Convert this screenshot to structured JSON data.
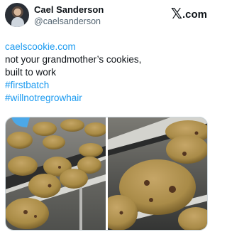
{
  "author": {
    "display_name": "Cael Sanderson",
    "handle": "@caelsanderson",
    "avatar_icon": "profile-avatar"
  },
  "brand": {
    "mark": "𝕏",
    "label": ".com"
  },
  "post": {
    "lines": [
      "caelscookie.com",
      "not your grandmother’s cookies,",
      "built to work",
      "#firstbatch",
      "#willnotregrowhair"
    ]
  },
  "media": {
    "photos": [
      {
        "icon": "cookies-on-conveyor-left-photo"
      },
      {
        "icon": "cookies-on-conveyor-right-photo"
      }
    ]
  },
  "colors": {
    "link": "#1d9bf0",
    "text": "#0f1419",
    "muted": "#536471",
    "border": "#cfd9de"
  }
}
